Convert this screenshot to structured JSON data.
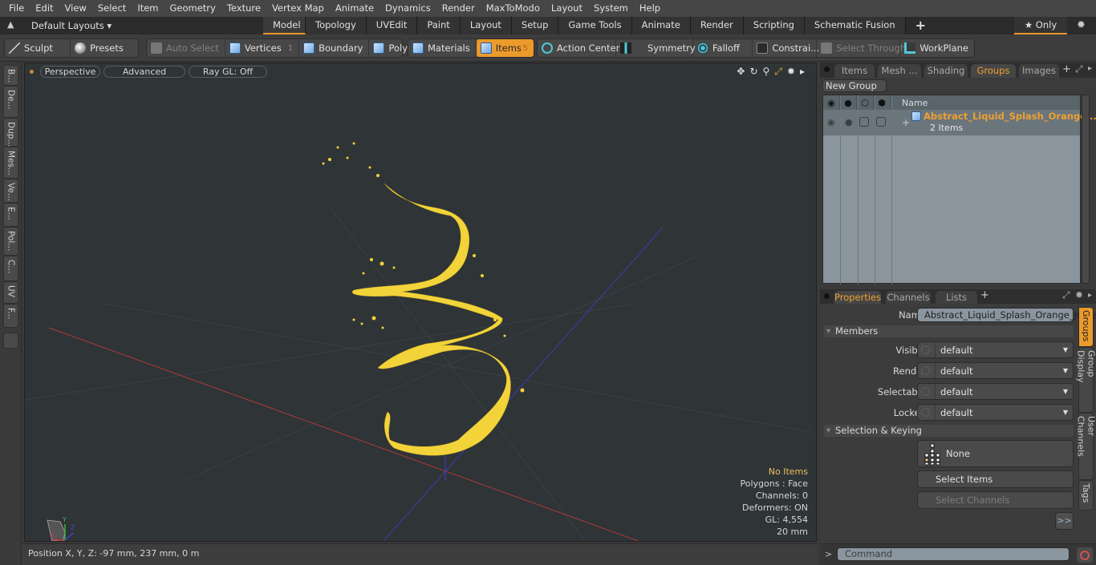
{
  "menu": [
    "File",
    "Edit",
    "View",
    "Select",
    "Item",
    "Geometry",
    "Texture",
    "Vertex Map",
    "Animate",
    "Dynamics",
    "Render",
    "MaxToModo",
    "Layout",
    "System",
    "Help"
  ],
  "layouts": {
    "dropdown_label": "Default Layouts ▾",
    "tabs": [
      "Model",
      "Topology",
      "UVEdit",
      "Paint",
      "Layout",
      "Setup",
      "Game Tools",
      "Animate",
      "Render",
      "Scripting",
      "Schematic Fusion"
    ],
    "active_tab": "Model",
    "add_label": "+",
    "only_label": "★ Only"
  },
  "toolbar": {
    "sculpt": "Sculpt",
    "presets": "Presets",
    "auto_select": "Auto Select",
    "vertices": "Vertices",
    "vertices_count": "1",
    "boundary": "Boundary",
    "polygons": "Polygons",
    "materials": "Materials",
    "items": "Items",
    "items_count": "5",
    "action_center": "Action Center",
    "symmetry": "Symmetry",
    "falloff": "Falloff",
    "constraints": "Constrai...",
    "select_through": "Select Through",
    "workplane": "WorkPlane"
  },
  "left_tabs": [
    "B...",
    "De...",
    "Dup...",
    "Mes...",
    "Ve...",
    "E...",
    "Pol...",
    "C...",
    "UV",
    "F..."
  ],
  "viewport": {
    "view_mode": "Perspective",
    "shading": "Advanced",
    "raygl": "Ray GL: Off",
    "info": {
      "selection": "No Items",
      "polygons": "Polygons : Face",
      "channels": "Channels: 0",
      "deformers": "Deformers: ON",
      "gl": "GL: 4,554",
      "grid": "20 mm"
    },
    "model_color": "#f2d43a",
    "axis_labels": {
      "x": "X",
      "y": "Y",
      "z": "Z"
    }
  },
  "status": {
    "position": "Position X, Y, Z:   -97 mm, 237 mm, 0 m"
  },
  "right_top": {
    "tabs": [
      "Items",
      "Mesh ...",
      "Shading",
      "Groups",
      "Images"
    ],
    "active_tab": "Groups",
    "new_group": "New Group",
    "column_name": "Name",
    "group": {
      "name": "Abstract_Liquid_Splash_Orange ...",
      "count": "2 Items"
    }
  },
  "properties": {
    "tabs": [
      "Properties",
      "Channels",
      "Lists"
    ],
    "active_tab": "Properties",
    "name_label": "Name",
    "name_value": "Abstract_Liquid_Splash_Orange_Juice",
    "members_section": "Members",
    "fields": [
      {
        "label": "Visible",
        "value": "default"
      },
      {
        "label": "Render",
        "value": "default"
      },
      {
        "label": "Selectable",
        "value": "default"
      },
      {
        "label": "Locked",
        "value": "default"
      }
    ],
    "keying_section": "Selection & Keying",
    "none_label": "None",
    "select_items": "Select Items",
    "select_channels": "Select Channels",
    "more": ">>",
    "side_tabs": [
      "Groups",
      "Group Display",
      "User Channels",
      "Tags"
    ]
  },
  "command": {
    "prompt": ">",
    "placeholder": "Command"
  },
  "colors": {
    "accent": "#eb9a2c",
    "highlight_text": "#f0a030"
  }
}
